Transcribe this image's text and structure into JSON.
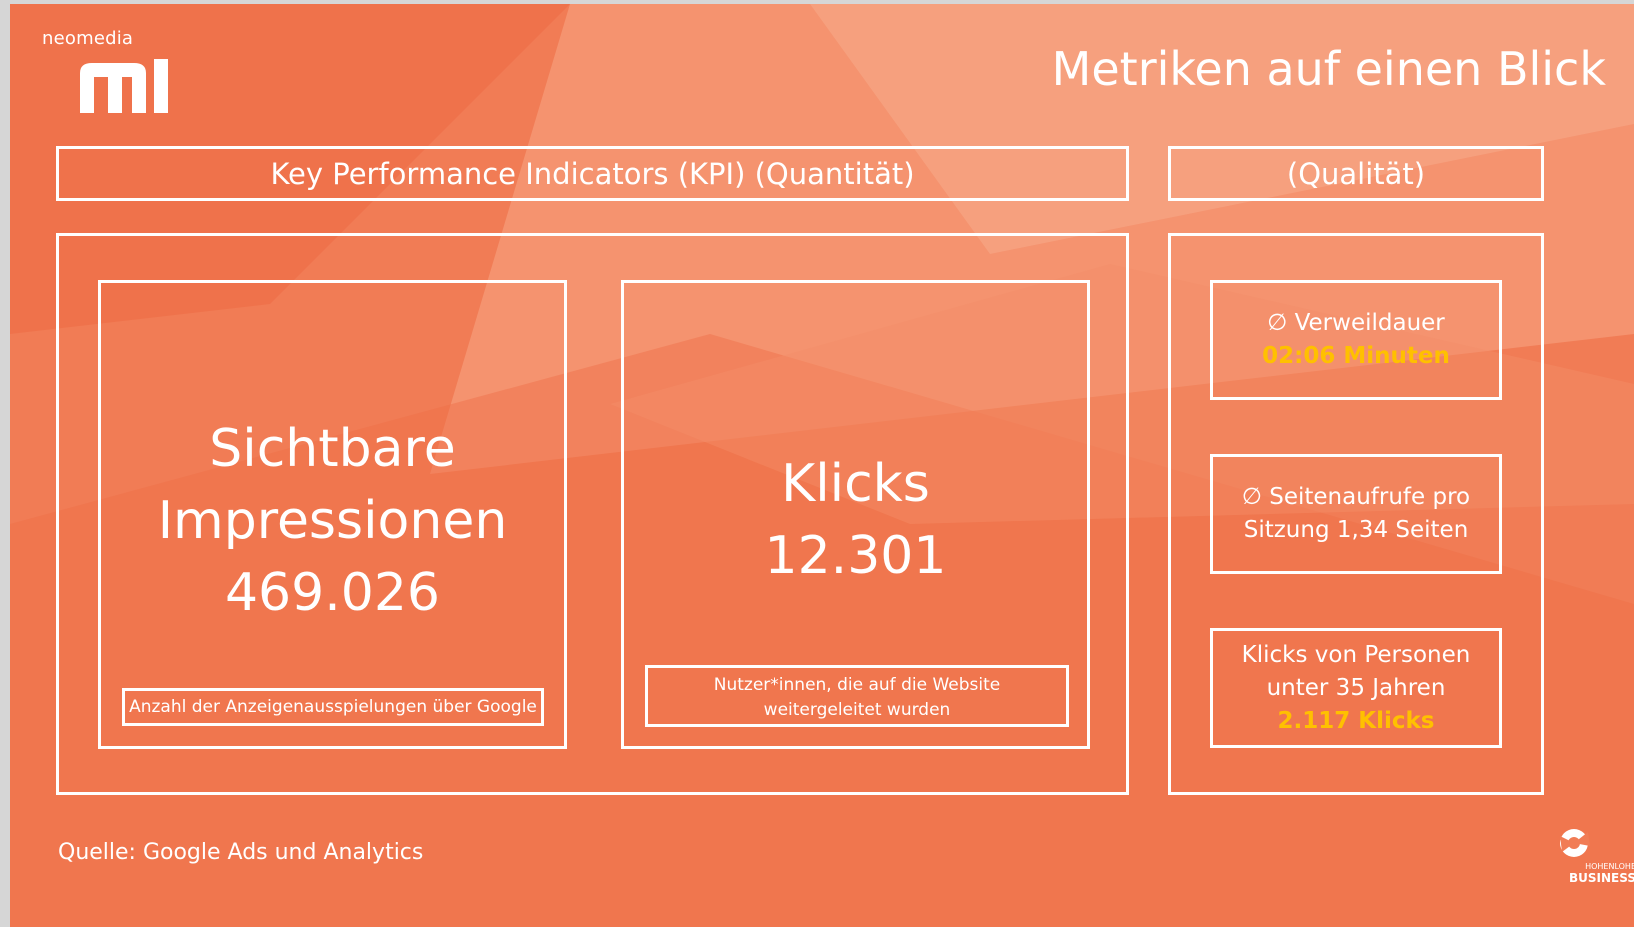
{
  "brand": {
    "logo_word": "neomedia",
    "logo_mark_icon": "neomedia-m-logo-icon",
    "footer_logo_icon": "hohenlohe-business-logo-icon",
    "footer_logo_line1": "HOHENLOHE",
    "footer_logo_line2": "BUSINESS"
  },
  "title": "Metriken auf einen Blick",
  "kpi": {
    "header": "Key Performance Indicators (KPI) (Quantität)",
    "impressions": {
      "line1": "Sichtbare",
      "line2": "Impressionen",
      "value": "469.026",
      "note": "Anzahl der Anzeigenausspielungen über Google"
    },
    "clicks": {
      "line1": "Klicks",
      "value": "12.301",
      "note_line1": "Nutzer*innen, die auf die Website",
      "note_line2": "weitergeleitet wurden"
    }
  },
  "quality": {
    "header": "(Qualität)",
    "dwell": {
      "label": "∅ Verweildauer",
      "value": "02:06 Minuten"
    },
    "pageviews": {
      "line1": "∅ Seitenaufrufe pro",
      "line2": "Sitzung 1,34 Seiten"
    },
    "young": {
      "line1": "Klicks von Personen",
      "line2": "unter 35 Jahren",
      "value": "2.117 Klicks"
    }
  },
  "source": "Quelle: Google Ads und Analytics",
  "colors": {
    "background": "#f17c55",
    "highlight": "#ffc000",
    "frame": "#ffffff"
  }
}
